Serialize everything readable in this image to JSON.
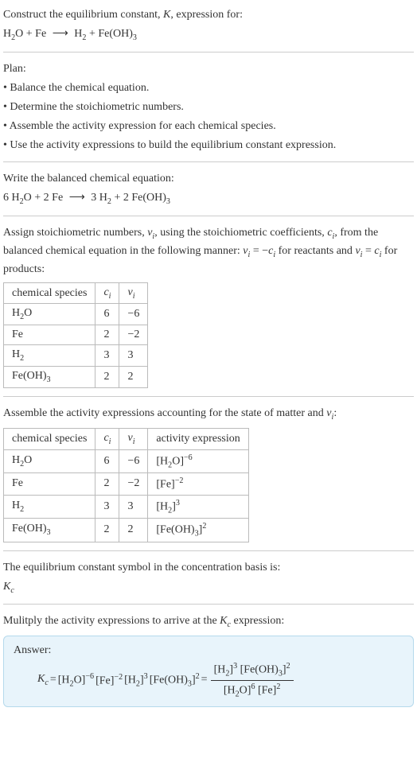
{
  "prompt": {
    "line1_a": "Construct the equilibrium constant, ",
    "line1_b": ", expression for:",
    "K": "K",
    "eq_unbalanced_lhs1": "H",
    "eq_unbalanced_lhs1_sub": "2",
    "eq_unbalanced_lhs2": "O + Fe ",
    "arrow": "⟶",
    "eq_unbalanced_rhs1": " H",
    "eq_unbalanced_rhs1_sub": "2",
    "eq_unbalanced_rhs2": " + Fe(OH)",
    "eq_unbalanced_rhs2_sub": "3"
  },
  "plan": {
    "heading": "Plan:",
    "b1": "• Balance the chemical equation.",
    "b2": "• Determine the stoichiometric numbers.",
    "b3": "• Assemble the activity expression for each chemical species.",
    "b4": "• Use the activity expressions to build the equilibrium constant expression."
  },
  "balanced": {
    "heading": "Write the balanced chemical equation:",
    "lhs": "6 H",
    "lhs_sub": "2",
    "lhs2": "O + 2 Fe ",
    "arrow": "⟶",
    "rhs": " 3 H",
    "rhs_sub": "2",
    "rhs2": " + 2 Fe(OH)",
    "rhs2_sub": "3"
  },
  "stoich_intro": {
    "a": "Assign stoichiometric numbers, ",
    "nu": "ν",
    "i": "i",
    "b": ", using the stoichiometric coefficients, ",
    "c": "c",
    "d": ", from the balanced chemical equation in the following manner: ",
    "eq1a": "ν",
    "eq1b": " = −",
    "eq1c": "c",
    "e": " for reactants and ",
    "eq2a": "ν",
    "eq2b": " = ",
    "eq2c": "c",
    "f": " for products:"
  },
  "table1": {
    "h1": "chemical species",
    "h2_a": "c",
    "h2_b": "i",
    "h3_a": "ν",
    "h3_b": "i",
    "rows": [
      {
        "sp_a": "H",
        "sp_sub": "2",
        "sp_b": "O",
        "c": "6",
        "nu": "−6"
      },
      {
        "sp_a": "Fe",
        "sp_sub": "",
        "sp_b": "",
        "c": "2",
        "nu": "−2"
      },
      {
        "sp_a": "H",
        "sp_sub": "2",
        "sp_b": "",
        "c": "3",
        "nu": "3"
      },
      {
        "sp_a": "Fe(OH)",
        "sp_sub": "3",
        "sp_b": "",
        "c": "2",
        "nu": "2"
      }
    ]
  },
  "activity_intro": {
    "a": "Assemble the activity expressions accounting for the state of matter and ",
    "nu": "ν",
    "i": "i",
    "b": ":"
  },
  "table2": {
    "h1": "chemical species",
    "h2_a": "c",
    "h2_b": "i",
    "h3_a": "ν",
    "h3_b": "i",
    "h4": "activity expression",
    "rows": [
      {
        "sp_a": "H",
        "sp_sub": "2",
        "sp_b": "O",
        "c": "6",
        "nu": "−6",
        "ae_a": "[H",
        "ae_sub": "2",
        "ae_b": "O]",
        "ae_sup": "−6"
      },
      {
        "sp_a": "Fe",
        "sp_sub": "",
        "sp_b": "",
        "c": "2",
        "nu": "−2",
        "ae_a": "[Fe]",
        "ae_sub": "",
        "ae_b": "",
        "ae_sup": "−2"
      },
      {
        "sp_a": "H",
        "sp_sub": "2",
        "sp_b": "",
        "c": "3",
        "nu": "3",
        "ae_a": "[H",
        "ae_sub": "2",
        "ae_b": "]",
        "ae_sup": "3"
      },
      {
        "sp_a": "Fe(OH)",
        "sp_sub": "3",
        "sp_b": "",
        "c": "2",
        "nu": "2",
        "ae_a": "[Fe(OH)",
        "ae_sub": "3",
        "ae_b": "]",
        "ae_sup": "2"
      }
    ]
  },
  "kc_symbol": {
    "a": "The equilibrium constant symbol in the concentration basis is:",
    "K": "K",
    "c": "c"
  },
  "multiply": {
    "a": "Mulitply the activity expressions to arrive at the ",
    "K": "K",
    "c": "c",
    "b": " expression:"
  },
  "answer": {
    "label": "Answer:",
    "Kc_K": "K",
    "Kc_c": "c",
    "eq": " = ",
    "t1_a": "[H",
    "t1_sub": "2",
    "t1_b": "O]",
    "t1_sup": "−6",
    "t2_a": " [Fe]",
    "t2_sup": "−2",
    "t3_a": " [H",
    "t3_sub": "2",
    "t3_b": "]",
    "t3_sup": "3",
    "t4_a": " [Fe(OH)",
    "t4_sub": "3",
    "t4_b": "]",
    "t4_sup": "2",
    "eq2": " = ",
    "num_a": "[H",
    "num_a_sub": "2",
    "num_a_b": "]",
    "num_a_sup": "3",
    "num_b": " [Fe(OH)",
    "num_b_sub": "3",
    "num_b_b": "]",
    "num_b_sup": "2",
    "den_a": "[H",
    "den_a_sub": "2",
    "den_a_b": "O]",
    "den_a_sup": "6",
    "den_b": " [Fe]",
    "den_b_sup": "2"
  }
}
